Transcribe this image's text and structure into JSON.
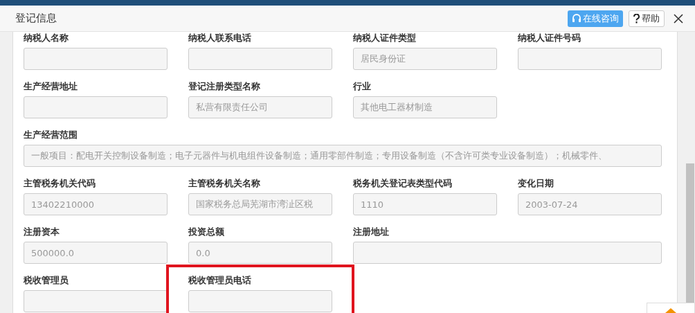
{
  "dialog": {
    "title": "登记信息",
    "buttons": [
      {
        "kind": "consult",
        "label": "在线咨询"
      },
      {
        "kind": "help",
        "label": "帮助"
      }
    ]
  },
  "form": {
    "rows": [
      {
        "fields": [
          {
            "label": "纳税人名称",
            "kind": "normal",
            "highlighted": false
          },
          {
            "label": "纳税人联系电话",
            "kind": "normal",
            "highlighted": false
          },
          {
            "label": "纳税人证件类型",
            "value": "居民身份证",
            "kind": "normal",
            "highlighted": false
          },
          {
            "label": "纳税人证件号码",
            "kind": "normal",
            "highlighted": false
          }
        ]
      },
      {
        "fields": [
          {
            "label": "生产经营地址",
            "kind": "normal",
            "highlighted": false
          },
          {
            "label": "登记注册类型名称",
            "value": "私营有限责任公司",
            "kind": "normal",
            "highlighted": false
          },
          {
            "label": "行业",
            "value": "其他电工器材制造",
            "kind": "normal",
            "highlighted": false
          }
        ]
      },
      {
        "fields": [
          {
            "label": "生产经营范围",
            "value": "一般项目：配电开关控制设备制造；电子元器件与机电组件设备制造；通用零部件制造；专用设备制造（不含许可类专业设备制造）；机械零件、",
            "kind": "wide",
            "highlighted": false
          }
        ]
      },
      {
        "fields": [
          {
            "label": "主管税务机关代码",
            "value": "13402210000",
            "kind": "normal",
            "highlighted": false
          },
          {
            "label": "主管税务机关名称",
            "value": "国家税务总局芜湖市湾沚区税",
            "kind": "normal",
            "highlighted": false
          },
          {
            "label": "税务机关登记表类型代码",
            "value": "1110",
            "kind": "normal",
            "highlighted": false
          },
          {
            "label": "变化日期",
            "value": "2003-07-24",
            "kind": "normal",
            "highlighted": false
          }
        ]
      },
      {
        "fields": [
          {
            "label": "注册资本",
            "value": "500000.0",
            "kind": "normal",
            "highlighted": false
          },
          {
            "label": "投资总额",
            "value": "0.0",
            "kind": "normal",
            "highlighted": false
          },
          {
            "label": "注册地址",
            "kind": "wide-half",
            "highlighted": false
          }
        ]
      },
      {
        "fields": [
          {
            "label": "税收管理员",
            "kind": "normal",
            "highlighted": false
          },
          {
            "label": "税收管理员电话",
            "kind": "normal",
            "highlighted": true
          }
        ]
      }
    ]
  }
}
